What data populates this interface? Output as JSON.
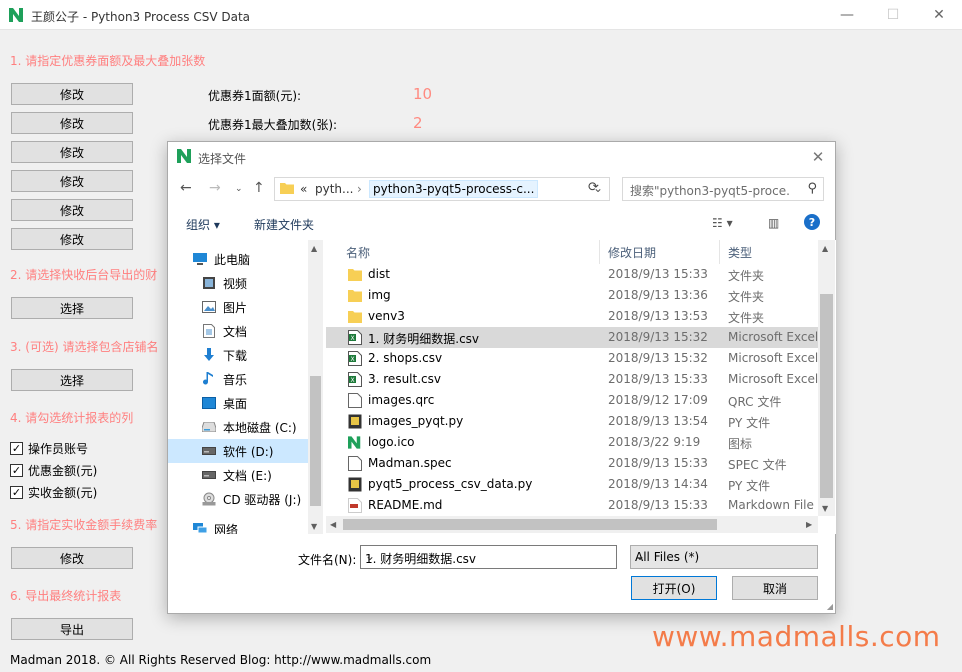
{
  "window": {
    "title": "王颜公子 - Python3 Process CSV Data",
    "minimize": "—",
    "maximize": "☐",
    "close": "✕"
  },
  "sections": {
    "s1": "1. 请指定优惠券面额及最大叠加张数",
    "s2": "2. 请选择快收后台导出的财",
    "s3": "3. (可选) 请选择包含店铺名",
    "s4": "4. 请勾选统计报表的列",
    "s5": "5. 请指定实收金额手续费率",
    "s6": "6. 导出最终统计报表"
  },
  "buttons": {
    "edit": "修改",
    "select": "选择",
    "export": "导出"
  },
  "coupon": {
    "face_label": "优惠券1面额(元):",
    "face_value": "10",
    "max_label": "优惠券1最大叠加数(张):",
    "max_value": "2"
  },
  "checkboxes": [
    {
      "label": "操作员账号",
      "checked": true
    },
    {
      "label": "优惠金额(元)",
      "checked": true
    },
    {
      "label": "实收金额(元)",
      "checked": true
    }
  ],
  "footer": "Madman 2018. © All Rights Reserved  Blog: http://www.madmalls.com",
  "watermark": "www.madmalls.com",
  "dialog": {
    "title": "选择文件",
    "address": {
      "prefix": "«",
      "crumb1": "pyth...",
      "sep": "›",
      "current": "python3-pyqt5-process-c..."
    },
    "search_placeholder": "搜索\"python3-pyqt5-proce...",
    "cmd_organize": "组织 ▾",
    "cmd_new_folder": "新建文件夹",
    "nav": [
      {
        "label": "此电脑",
        "icon": "computer-icon"
      },
      {
        "label": "视频",
        "icon": "video-icon"
      },
      {
        "label": "图片",
        "icon": "picture-icon"
      },
      {
        "label": "文档",
        "icon": "document-icon"
      },
      {
        "label": "下载",
        "icon": "download-icon"
      },
      {
        "label": "音乐",
        "icon": "music-icon"
      },
      {
        "label": "桌面",
        "icon": "desktop-icon"
      },
      {
        "label": "本地磁盘 (C:)",
        "icon": "drive-icon"
      },
      {
        "label": "软件 (D:)",
        "icon": "drive-icon"
      },
      {
        "label": "文档 (E:)",
        "icon": "drive-icon"
      },
      {
        "label": "CD 驱动器 (J:)",
        "icon": "cd-drive-icon"
      },
      {
        "label": "网络",
        "icon": "network-icon"
      }
    ],
    "columns": {
      "name": "名称",
      "date": "修改日期",
      "type": "类型"
    },
    "files": [
      {
        "name": "dist",
        "date": "2018/9/13 15:33",
        "type": "文件夹",
        "icon": "folder-icon"
      },
      {
        "name": "img",
        "date": "2018/9/13 13:36",
        "type": "文件夹",
        "icon": "folder-icon"
      },
      {
        "name": "venv3",
        "date": "2018/9/13 13:53",
        "type": "文件夹",
        "icon": "folder-icon"
      },
      {
        "name": "1. 财务明细数据.csv",
        "date": "2018/9/13 15:32",
        "type": "Microsoft Excel",
        "icon": "excel-icon"
      },
      {
        "name": "2. shops.csv",
        "date": "2018/9/13 15:32",
        "type": "Microsoft Excel",
        "icon": "excel-icon"
      },
      {
        "name": "3. result.csv",
        "date": "2018/9/13 15:33",
        "type": "Microsoft Excel",
        "icon": "excel-icon"
      },
      {
        "name": "images.qrc",
        "date": "2018/9/12 17:09",
        "type": "QRC 文件",
        "icon": "file-icon"
      },
      {
        "name": "images_pyqt.py",
        "date": "2018/9/13 13:54",
        "type": "PY 文件",
        "icon": "python-file-icon"
      },
      {
        "name": "logo.ico",
        "date": "2018/3/22 9:19",
        "type": "图标",
        "icon": "logo-icon"
      },
      {
        "name": "Madman.spec",
        "date": "2018/9/13 15:33",
        "type": "SPEC 文件",
        "icon": "file-icon"
      },
      {
        "name": "pyqt5_process_csv_data.py",
        "date": "2018/9/13 14:34",
        "type": "PY 文件",
        "icon": "python-file-icon"
      },
      {
        "name": "README.md",
        "date": "2018/9/13 15:33",
        "type": "Markdown File",
        "icon": "markdown-file-icon"
      }
    ],
    "filename_label": "文件名(N):",
    "filename_value": "1. 财务明细数据.csv",
    "filetype_value": "All Files  (*)",
    "open": "打开(O)",
    "cancel": "取消"
  }
}
